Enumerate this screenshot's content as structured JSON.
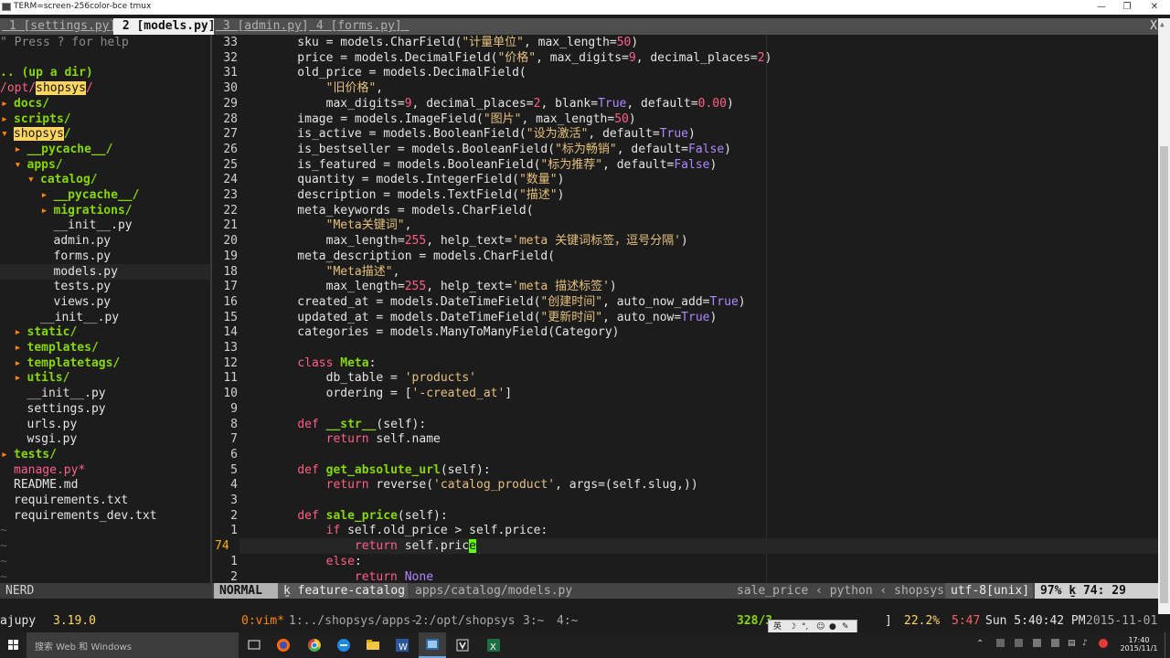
{
  "window": {
    "title": "TERM=screen-256color-bce tmux",
    "min_icon": "minimize-icon",
    "max_icon": "restore-icon",
    "close_icon": "close-icon"
  },
  "tabs": [
    {
      "label": " 1 [settings.py] ",
      "selected": false
    },
    {
      "label": " 2 [models.py] ",
      "selected": true
    },
    {
      "label": " 3 [admin.py] ",
      "selected": false
    },
    {
      "label": " 4 [forms.py] ",
      "selected": false
    }
  ],
  "tab_close": "X",
  "tree": {
    "help": "\" Press ? for help",
    "updir": ".. (up a dir)",
    "root_prefix": "/opt/",
    "root_name": "shopsys",
    "root_suffix": "/",
    "items": [
      {
        "indent": 0,
        "arrow": "▸",
        "name": "docs/",
        "type": "dir"
      },
      {
        "indent": 0,
        "arrow": "▸",
        "name": "scripts/",
        "type": "dir"
      },
      {
        "indent": 0,
        "arrow": "▾",
        "name": "shopsys",
        "suffix": "/",
        "type": "dir",
        "highlight": true
      },
      {
        "indent": 1,
        "arrow": "▸",
        "name": "__pycache__/",
        "type": "dir"
      },
      {
        "indent": 1,
        "arrow": "▾",
        "name": "apps/",
        "type": "dir"
      },
      {
        "indent": 2,
        "arrow": "▾",
        "name": "catalog/",
        "type": "dir"
      },
      {
        "indent": 3,
        "arrow": "▸",
        "name": "__pycache__/",
        "type": "dir"
      },
      {
        "indent": 3,
        "arrow": "▸",
        "name": "migrations/",
        "type": "dir"
      },
      {
        "indent": 3,
        "arrow": "",
        "name": "__init__.py",
        "type": "file"
      },
      {
        "indent": 3,
        "arrow": "",
        "name": "admin.py",
        "type": "file"
      },
      {
        "indent": 3,
        "arrow": "",
        "name": "forms.py",
        "type": "file"
      },
      {
        "indent": 3,
        "arrow": "",
        "name": "models.py",
        "type": "file",
        "current": true
      },
      {
        "indent": 3,
        "arrow": "",
        "name": "tests.py",
        "type": "file"
      },
      {
        "indent": 3,
        "arrow": "",
        "name": "views.py",
        "type": "file"
      },
      {
        "indent": 2,
        "arrow": "",
        "name": "__init__.py",
        "type": "file"
      },
      {
        "indent": 1,
        "arrow": "▸",
        "name": "static/",
        "type": "dir"
      },
      {
        "indent": 1,
        "arrow": "▸",
        "name": "templates/",
        "type": "dir"
      },
      {
        "indent": 1,
        "arrow": "▸",
        "name": "templatetags/",
        "type": "dir"
      },
      {
        "indent": 1,
        "arrow": "▸",
        "name": "utils/",
        "type": "dir"
      },
      {
        "indent": 1,
        "arrow": "",
        "name": "__init__.py",
        "type": "file"
      },
      {
        "indent": 1,
        "arrow": "",
        "name": "settings.py",
        "type": "file"
      },
      {
        "indent": 1,
        "arrow": "",
        "name": "urls.py",
        "type": "file"
      },
      {
        "indent": 1,
        "arrow": "",
        "name": "wsgi.py",
        "type": "file"
      },
      {
        "indent": 0,
        "arrow": "▸",
        "name": "tests/",
        "type": "dir"
      },
      {
        "indent": 0,
        "arrow": "",
        "name": "manage.py*",
        "type": "exec"
      },
      {
        "indent": 0,
        "arrow": "",
        "name": "README.md",
        "type": "file"
      },
      {
        "indent": 0,
        "arrow": "",
        "name": "requirements.txt",
        "type": "file"
      },
      {
        "indent": 0,
        "arrow": "",
        "name": "requirements_dev.txt",
        "type": "file"
      }
    ],
    "tildes": [
      "~",
      "~",
      "~",
      "~"
    ]
  },
  "editor": {
    "lines": [
      {
        "n": "33",
        "s": [
          [
            "    sku = models.CharField(",
            ""
          ],
          [
            "\"计量单位\"",
            "str"
          ],
          [
            ", max_length=",
            ""
          ],
          [
            "50",
            "num"
          ],
          [
            ")",
            ""
          ]
        ]
      },
      {
        "n": "32",
        "s": [
          [
            "    price = models.DecimalField(",
            ""
          ],
          [
            "\"价格\"",
            "str"
          ],
          [
            ", max_digits=",
            ""
          ],
          [
            "9",
            "num"
          ],
          [
            ", decimal_places=",
            ""
          ],
          [
            "2",
            "num"
          ],
          [
            ")",
            ""
          ]
        ]
      },
      {
        "n": "31",
        "s": [
          [
            "    old_price = models.DecimalField(",
            ""
          ]
        ]
      },
      {
        "n": "30",
        "s": [
          [
            "        ",
            ""
          ],
          [
            "\"旧价格\"",
            "str"
          ],
          [
            ",",
            ""
          ]
        ]
      },
      {
        "n": "29",
        "s": [
          [
            "        max_digits=",
            ""
          ],
          [
            "9",
            "num"
          ],
          [
            ", decimal_places=",
            ""
          ],
          [
            "2",
            "num"
          ],
          [
            ", blank=",
            ""
          ],
          [
            "True",
            "bi"
          ],
          [
            ", default=",
            ""
          ],
          [
            "0.00",
            "num"
          ],
          [
            ")",
            ""
          ]
        ]
      },
      {
        "n": "28",
        "s": [
          [
            "    image = models.ImageField(",
            ""
          ],
          [
            "\"图片\"",
            "str"
          ],
          [
            ", max_length=",
            ""
          ],
          [
            "50",
            "num"
          ],
          [
            ")",
            ""
          ]
        ]
      },
      {
        "n": "27",
        "s": [
          [
            "    is_active = models.BooleanField(",
            ""
          ],
          [
            "\"设为激活\"",
            "str"
          ],
          [
            ", default=",
            ""
          ],
          [
            "True",
            "bi"
          ],
          [
            ")",
            ""
          ]
        ]
      },
      {
        "n": "26",
        "s": [
          [
            "    is_bestseller = models.BooleanField(",
            ""
          ],
          [
            "\"标为畅销\"",
            "str"
          ],
          [
            ", default=",
            ""
          ],
          [
            "False",
            "bi"
          ],
          [
            ")",
            ""
          ]
        ]
      },
      {
        "n": "25",
        "s": [
          [
            "    is_featured = models.BooleanField(",
            ""
          ],
          [
            "\"标为推荐\"",
            "str"
          ],
          [
            ", default=",
            ""
          ],
          [
            "False",
            "bi"
          ],
          [
            ")",
            ""
          ]
        ]
      },
      {
        "n": "24",
        "s": [
          [
            "    quantity = models.IntegerField(",
            ""
          ],
          [
            "\"数量\"",
            "str"
          ],
          [
            ")",
            ""
          ]
        ]
      },
      {
        "n": "23",
        "s": [
          [
            "    description = models.TextField(",
            ""
          ],
          [
            "\"描述\"",
            "str"
          ],
          [
            ")",
            ""
          ]
        ]
      },
      {
        "n": "22",
        "s": [
          [
            "    meta_keywords = models.CharField(",
            ""
          ]
        ]
      },
      {
        "n": "21",
        "s": [
          [
            "        ",
            ""
          ],
          [
            "\"Meta关键词\"",
            "str"
          ],
          [
            ",",
            ""
          ]
        ]
      },
      {
        "n": "20",
        "s": [
          [
            "        max_length=",
            ""
          ],
          [
            "255",
            "num"
          ],
          [
            ", help_text=",
            ""
          ],
          [
            "'meta 关键词标签，逗号分隔'",
            "str"
          ],
          [
            ")",
            ""
          ]
        ]
      },
      {
        "n": "19",
        "s": [
          [
            "    meta_description = models.CharField(",
            ""
          ]
        ]
      },
      {
        "n": "18",
        "s": [
          [
            "        ",
            ""
          ],
          [
            "\"Meta描述\"",
            "str"
          ],
          [
            ",",
            ""
          ]
        ]
      },
      {
        "n": "17",
        "s": [
          [
            "        max_length=",
            ""
          ],
          [
            "255",
            "num"
          ],
          [
            ", help_text=",
            ""
          ],
          [
            "'meta 描述标签'",
            "str"
          ],
          [
            ")",
            ""
          ]
        ]
      },
      {
        "n": "16",
        "s": [
          [
            "    created_at = models.DateTimeField(",
            ""
          ],
          [
            "\"创建时间\"",
            "str"
          ],
          [
            ", auto_now_add=",
            ""
          ],
          [
            "True",
            "bi"
          ],
          [
            ")",
            ""
          ]
        ]
      },
      {
        "n": "15",
        "s": [
          [
            "    updated_at = models.DateTimeField(",
            ""
          ],
          [
            "\"更新时间\"",
            "str"
          ],
          [
            ", auto_now=",
            ""
          ],
          [
            "True",
            "bi"
          ],
          [
            ")",
            ""
          ]
        ]
      },
      {
        "n": "14",
        "s": [
          [
            "    categories = models.ManyToManyField(Category)",
            ""
          ]
        ]
      },
      {
        "n": "13",
        "s": []
      },
      {
        "n": "12",
        "s": [
          [
            "    ",
            ""
          ],
          [
            "class",
            "kw"
          ],
          [
            " ",
            ""
          ],
          [
            "Meta",
            "cls"
          ],
          [
            ":",
            ""
          ]
        ]
      },
      {
        "n": "11",
        "s": [
          [
            "        db_table = ",
            ""
          ],
          [
            "'products'",
            "str"
          ]
        ]
      },
      {
        "n": "10",
        "s": [
          [
            "        ordering = [",
            ""
          ],
          [
            "'-created_at'",
            "str"
          ],
          [
            "]",
            ""
          ]
        ]
      },
      {
        "n": "9",
        "s": []
      },
      {
        "n": "8",
        "s": [
          [
            "    ",
            ""
          ],
          [
            "def",
            "kw"
          ],
          [
            " ",
            ""
          ],
          [
            "__str__",
            "fn"
          ],
          [
            "(self):",
            ""
          ]
        ]
      },
      {
        "n": "7",
        "s": [
          [
            "        ",
            ""
          ],
          [
            "return",
            "kw"
          ],
          [
            " self.name",
            ""
          ]
        ]
      },
      {
        "n": "6",
        "s": []
      },
      {
        "n": "5",
        "s": [
          [
            "    ",
            ""
          ],
          [
            "def",
            "kw"
          ],
          [
            " ",
            ""
          ],
          [
            "get_absolute_url",
            "fn"
          ],
          [
            "(self):",
            ""
          ]
        ]
      },
      {
        "n": "4",
        "s": [
          [
            "        ",
            ""
          ],
          [
            "return",
            "kw"
          ],
          [
            " reverse(",
            ""
          ],
          [
            "'catalog_product'",
            "str"
          ],
          [
            ", args=(self.slug,))",
            ""
          ]
        ]
      },
      {
        "n": "3",
        "s": []
      },
      {
        "n": "2",
        "s": [
          [
            "    ",
            ""
          ],
          [
            "def",
            "kw"
          ],
          [
            " ",
            ""
          ],
          [
            "sale_price",
            "fn"
          ],
          [
            "(self):",
            ""
          ]
        ]
      },
      {
        "n": "1",
        "s": [
          [
            "        ",
            ""
          ],
          [
            "if",
            "kw"
          ],
          [
            " self.old_price > self.price:",
            ""
          ]
        ]
      },
      {
        "n": "74",
        "current": true,
        "s": [
          [
            "            ",
            ""
          ],
          [
            "return",
            "kw"
          ],
          [
            " self.pric",
            ""
          ],
          [
            "e",
            "cursor"
          ]
        ]
      },
      {
        "n": "1",
        "s": [
          [
            "        ",
            ""
          ],
          [
            "else",
            "kw"
          ],
          [
            ":",
            ""
          ]
        ]
      },
      {
        "n": "2",
        "s": [
          [
            "            ",
            ""
          ],
          [
            "return",
            "kw"
          ],
          [
            " ",
            ""
          ],
          [
            "None",
            "bi"
          ]
        ]
      }
    ]
  },
  "statusline": {
    "nerd": "NERD",
    "mode": "NORMAL",
    "branch_icon": "branch-icon",
    "branch": "feature-catalog",
    "file": "apps/catalog/models.py",
    "funcpath": "sale_price ‹ python ‹ shopsys",
    "encoding": "utf-8[unix]",
    "percent": "97%",
    "lineno_icon": "line-number-icon",
    "position": "74: 29"
  },
  "tmux": {
    "session": "ajupy",
    "version": "3.19.0",
    "win0": "0:vim*",
    "win1": "1:../shopsys/apps-",
    "win2": "2:/opt/shopsys",
    "win3": "3:~",
    "win4": "4:~",
    "mem": "328/3",
    "bracket": "]",
    "cpu": "22.2%",
    "time_short": "5:47",
    "datetime": "Sun 5:40:42 PM",
    "date": "2015-11-01"
  },
  "ime": {
    "lang": "英"
  },
  "taskbar": {
    "search_placeholder": "搜索 Web 和 Windows",
    "clock_time": "17:40",
    "clock_date": "2015/11/1",
    "colors": {
      "chrome": "#4caf50",
      "edge": "#1e88e5",
      "word": "#2b579a",
      "firefox": "#ff6d00",
      "excel": "#1d6f42"
    }
  }
}
